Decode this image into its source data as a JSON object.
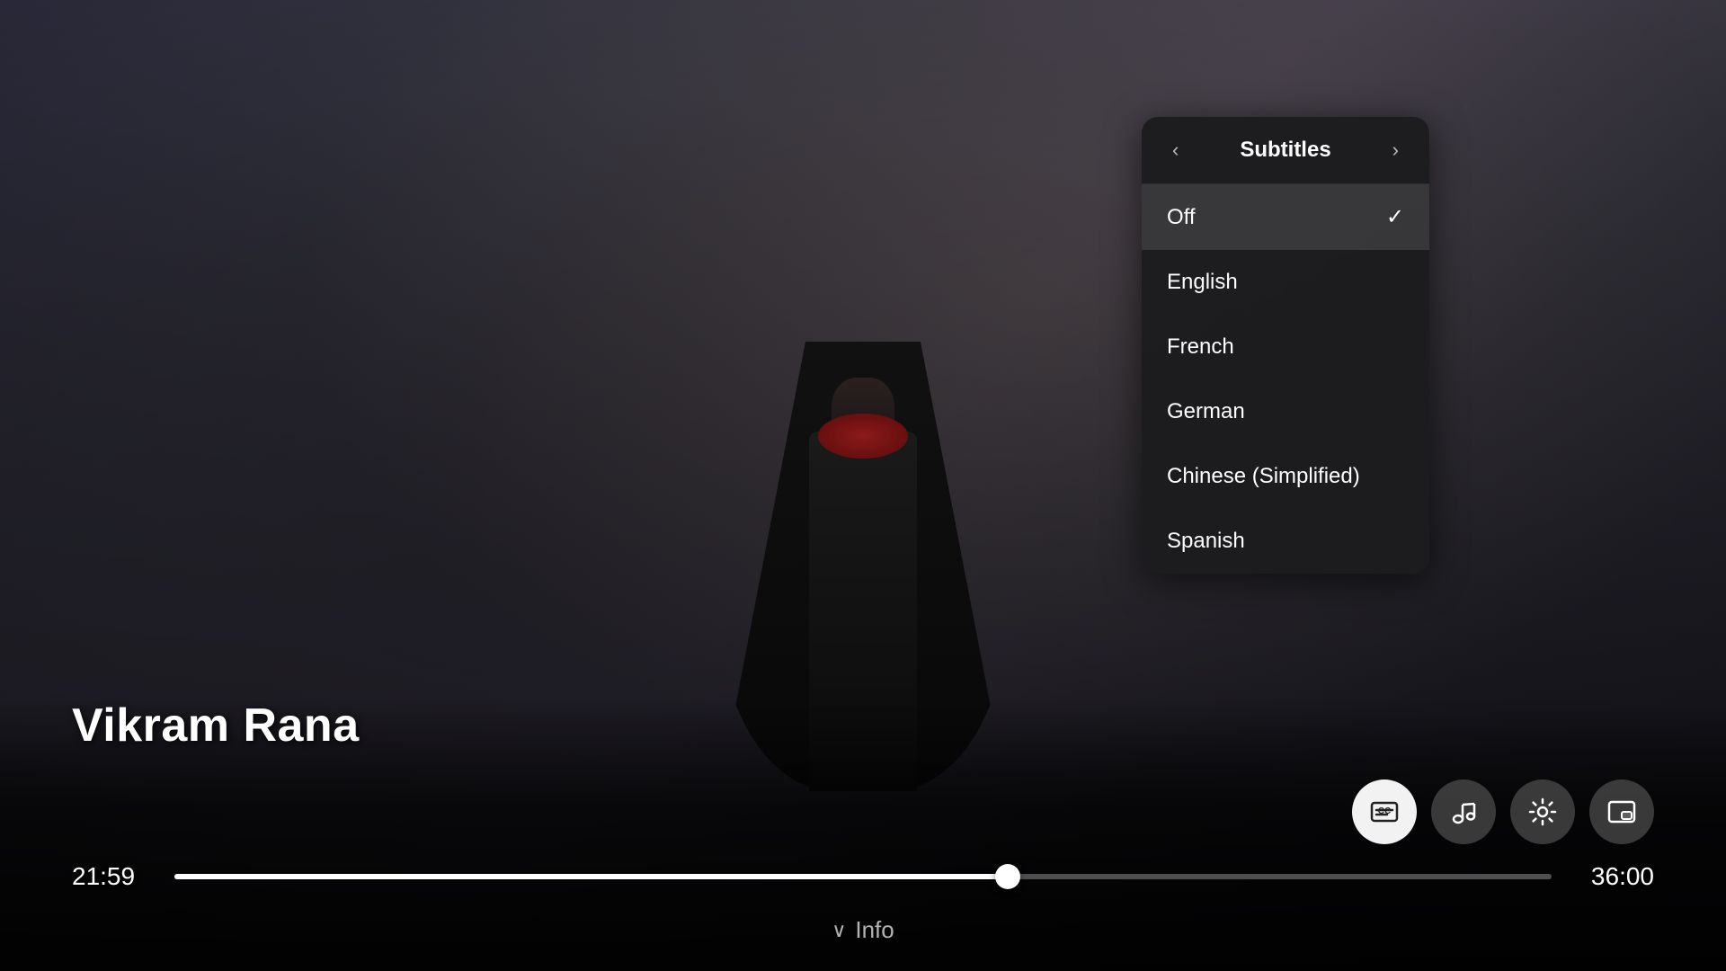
{
  "video": {
    "title": "Vikram Rana",
    "current_time": "21:59",
    "end_time": "36:00",
    "progress_percent": 60.5
  },
  "subtitles_panel": {
    "header": "Subtitles",
    "nav_prev": "‹",
    "nav_next": "›",
    "options": [
      {
        "id": "off",
        "label": "Off",
        "selected": true
      },
      {
        "id": "english",
        "label": "English",
        "selected": false
      },
      {
        "id": "french",
        "label": "French",
        "selected": false
      },
      {
        "id": "german",
        "label": "German",
        "selected": false
      },
      {
        "id": "chinese_simplified",
        "label": "Chinese (Simplified)",
        "selected": false
      },
      {
        "id": "spanish",
        "label": "Spanish",
        "selected": false
      }
    ]
  },
  "controls": {
    "subtitle_icon": "⊡",
    "music_icon": "♪",
    "settings_icon": "⚙",
    "pip_icon": "⧉"
  },
  "info_bar": {
    "chevron": "∨",
    "label": "Info"
  }
}
